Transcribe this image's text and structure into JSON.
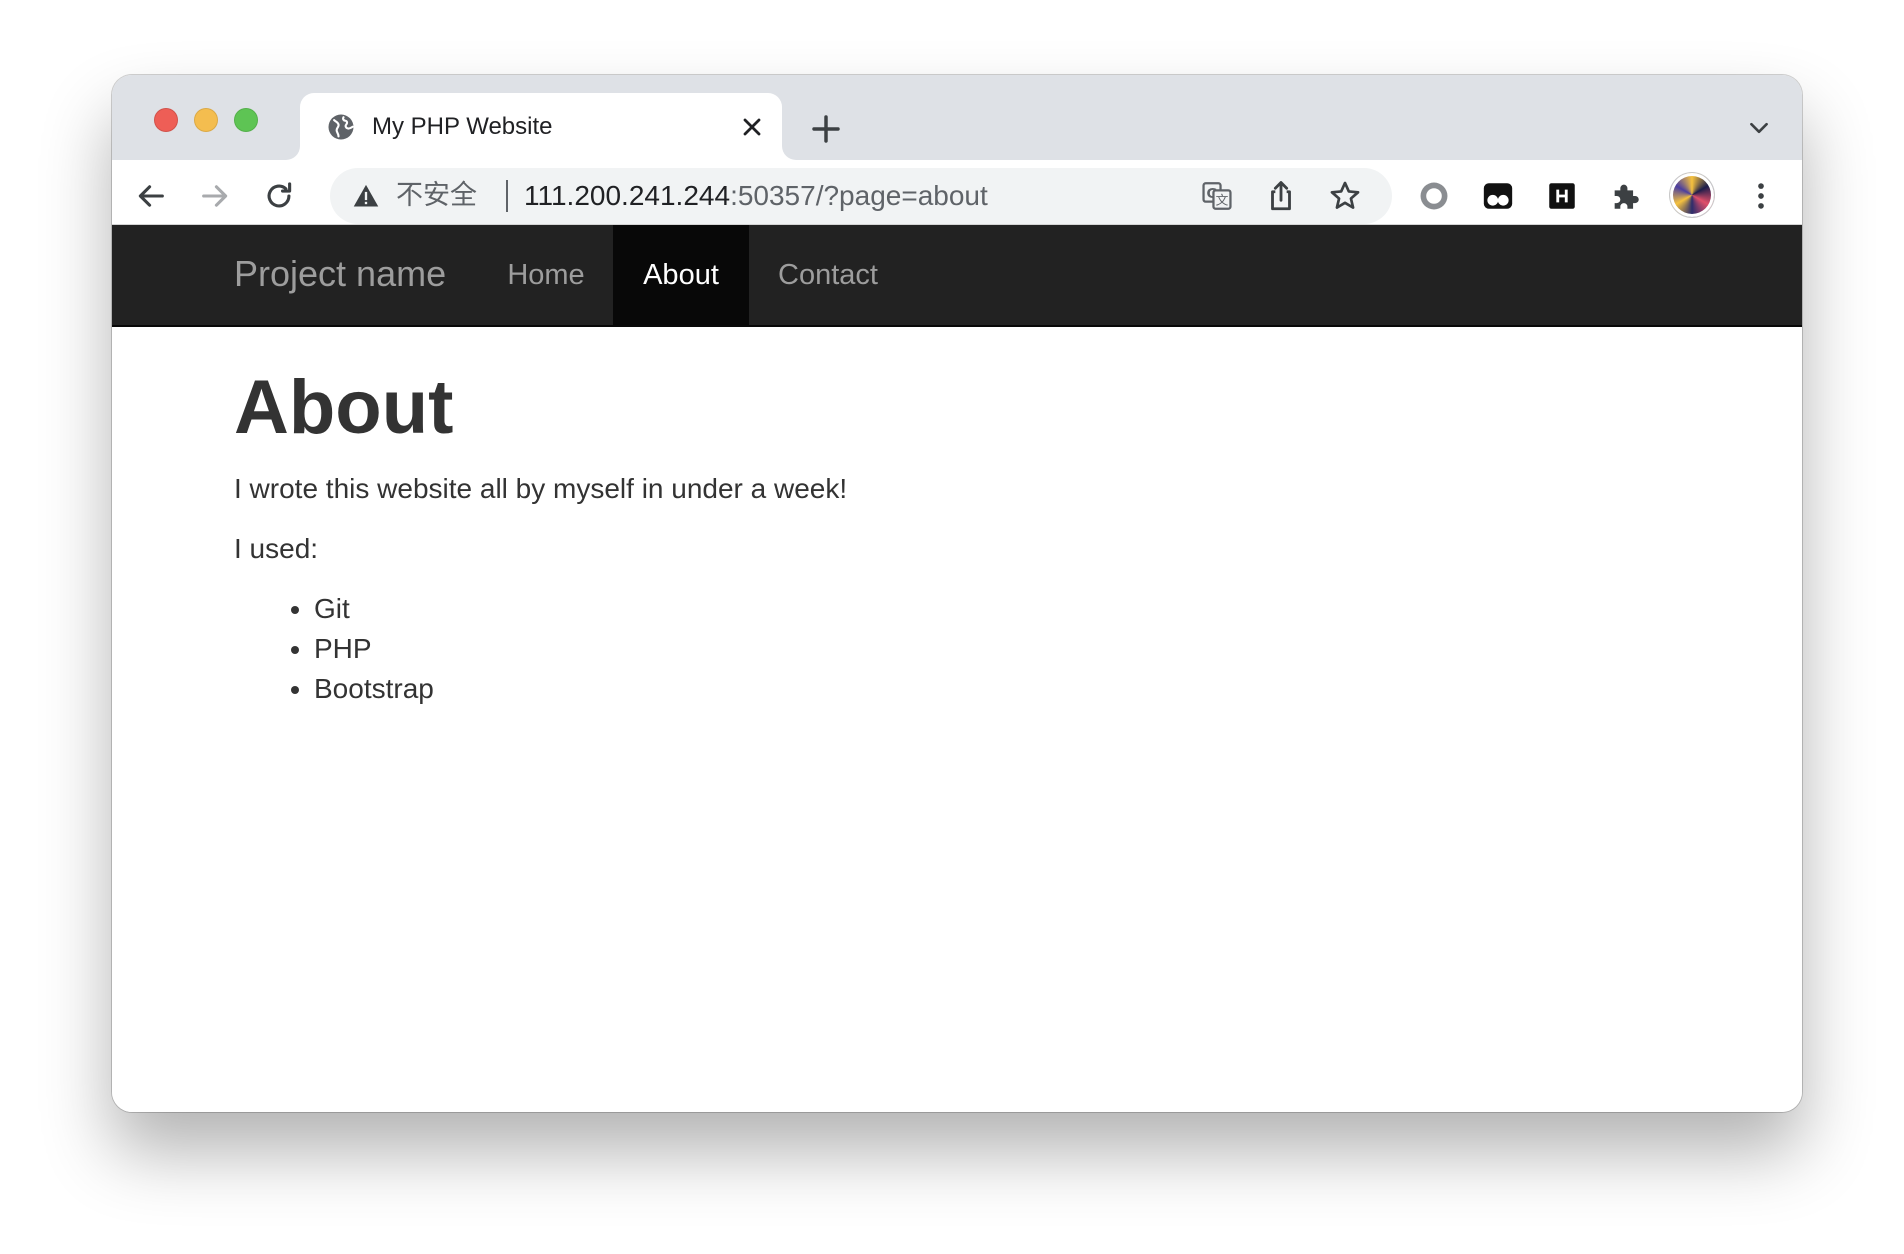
{
  "browser": {
    "tab": {
      "title": "My PHP Website",
      "favicon": "globe-icon"
    },
    "omnibox": {
      "security_label": "不安全",
      "url_host": "111.200.241.244",
      "url_rest": ":50357/?page=about"
    },
    "extensions": [
      "record-icon",
      "eyes-extension-icon",
      "h-extension-icon",
      "puzzle-icon"
    ],
    "colors": {
      "tab_strip": "#dee1e6",
      "omnibox": "#f1f3f4",
      "close_red": "#ee5e56",
      "minimize_yellow": "#f4bd4f",
      "maximize_green": "#5ec454"
    }
  },
  "site": {
    "navbar": {
      "brand": "Project name",
      "items": [
        {
          "label": "Home",
          "active": false
        },
        {
          "label": "About",
          "active": true
        },
        {
          "label": "Contact",
          "active": false
        }
      ],
      "background": "#222222"
    },
    "heading": "About",
    "intro": "I wrote this website all by myself in under a week!",
    "used_label": "I used:",
    "tools": [
      "Git",
      "PHP",
      "Bootstrap"
    ]
  }
}
